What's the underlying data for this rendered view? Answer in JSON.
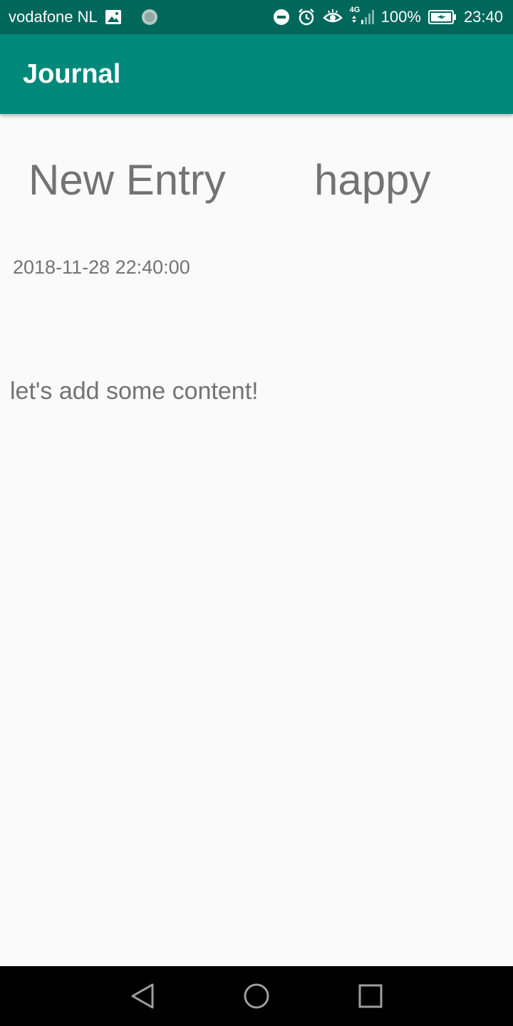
{
  "status_bar": {
    "carrier": "vodafone NL",
    "network": "4G",
    "battery": "100%",
    "time": "23:40",
    "icons": [
      "image-icon",
      "sync-icon",
      "do-not-disturb-icon",
      "alarm-icon",
      "eye-icon",
      "signal-icon",
      "battery-icon"
    ]
  },
  "app_bar": {
    "title": "Journal",
    "color": "#00897b",
    "status_color": "#00675b"
  },
  "entry": {
    "title": "New Entry",
    "mood": "happy",
    "timestamp": "2018-11-28 22:40:00",
    "content": "let's add some content!"
  },
  "nav_bar": {
    "buttons": [
      "back-icon",
      "home-icon",
      "recents-icon"
    ]
  }
}
